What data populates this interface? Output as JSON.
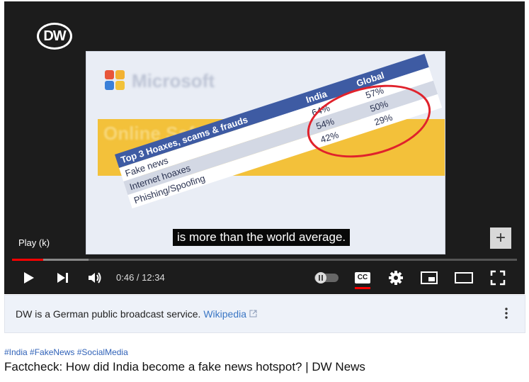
{
  "player": {
    "logo_text": "DW",
    "tooltip": "Play (k)",
    "subtitle": "is more than the world average.",
    "time_current": "0:46",
    "time_sep": " / ",
    "time_total": "12:34",
    "progress_fraction": 0.062,
    "cc_label": "CC",
    "plus_label": "+"
  },
  "slide": {
    "brand": "Microsoft",
    "band_text": "Online Safety",
    "table": {
      "title": "Top 3 Hoaxes, scams & frauds",
      "col_india": "India",
      "col_global": "Global",
      "rows": [
        {
          "label": "Fake news",
          "india": "64%",
          "global": "57%"
        },
        {
          "label": "Internet hoaxes",
          "india": "54%",
          "global": "50%"
        },
        {
          "label": "Phishing/Spoofing",
          "india": "42%",
          "global": "29%"
        }
      ]
    }
  },
  "info": {
    "text": "DW is a German public broadcast service.",
    "link": "Wikipedia",
    "link_icon": "external-link-icon"
  },
  "video": {
    "tags": "#India #FakeNews #SocialMedia",
    "title": "Factcheck: How did India become a fake news hotspot? | DW News"
  },
  "colors": {
    "progress": "#ff0000",
    "circle": "#e0222c",
    "table_header": "#3e5ba3",
    "band": "#f3c13a"
  }
}
